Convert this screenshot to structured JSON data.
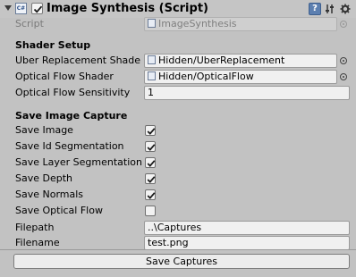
{
  "component": {
    "title": "Image Synthesis (Script)",
    "script_label": "Script",
    "script_value": "ImageSynthesis"
  },
  "shader_setup": {
    "heading": "Shader Setup",
    "uber_label": "Uber Replacement Shade",
    "uber_value": "Hidden/UberReplacement",
    "optical_label": "Optical Flow Shader",
    "optical_value": "Hidden/OpticalFlow",
    "sensitivity_label": "Optical Flow Sensitivity",
    "sensitivity_value": "1"
  },
  "save_capture": {
    "heading": "Save Image Capture",
    "toggles": [
      {
        "label": "Save Image",
        "checked": true
      },
      {
        "label": "Save Id Segmentation",
        "checked": true
      },
      {
        "label": "Save Layer Segmentation",
        "checked": true
      },
      {
        "label": "Save Depth",
        "checked": true
      },
      {
        "label": "Save Normals",
        "checked": true
      },
      {
        "label": "Save Optical Flow",
        "checked": false
      }
    ],
    "filepath_label": "Filepath",
    "filepath_value": "..\\Captures",
    "filename_label": "Filename",
    "filename_value": "test.png"
  },
  "button_label": "Save Captures",
  "icons": [
    "foldout-arrow-icon",
    "script-icon",
    "help-icon",
    "preset-icon",
    "gear-icon",
    "object-picker-icon"
  ]
}
